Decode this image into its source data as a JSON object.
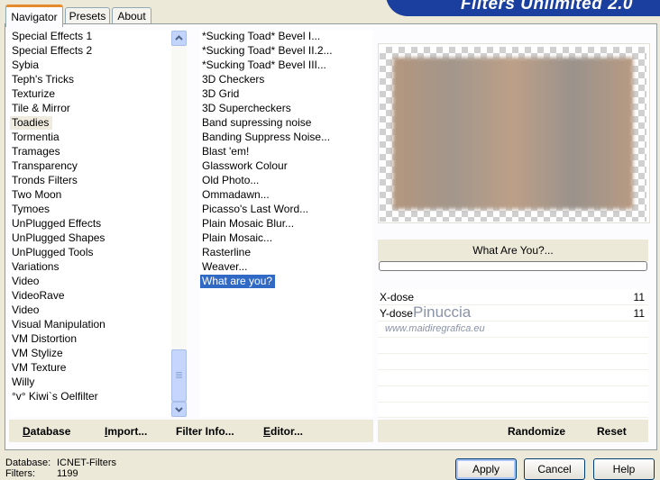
{
  "tabs": [
    "Navigator",
    "Presets",
    "About"
  ],
  "title": "Filters Unlimited 2.0",
  "categories": [
    "Special Effects 1",
    "Special Effects 2",
    "Sybia",
    "Teph's Tricks",
    "Texturize",
    "Tile & Mirror",
    "Toadies",
    "Tormentia",
    "Tramages",
    "Transparency",
    "Tronds Filters",
    "Two Moon",
    "Tymoes",
    "UnPlugged Effects",
    "UnPlugged Shapes",
    "UnPlugged Tools",
    "Variations",
    "Video",
    "VideoRave",
    "Video",
    "Visual Manipulation",
    "VM Distortion",
    "VM Stylize",
    "VM Texture",
    "Willy",
    "°v° Kiwi`s Oelfilter"
  ],
  "filters": [
    "*Sucking Toad*  Bevel I...",
    "*Sucking Toad*  Bevel II.2...",
    "*Sucking Toad*  Bevel III...",
    "3D Checkers",
    "3D Grid",
    "3D Supercheckers",
    "Band supressing noise",
    "Banding Suppress Noise...",
    "Blast 'em!",
    "Glasswork Colour",
    "Old Photo...",
    "Ommadawn...",
    "Picasso's Last Word...",
    "Plain Mosaic Blur...",
    "Plain Mosaic...",
    "Rasterline",
    "Weaver...",
    "What are you?"
  ],
  "highlighted_category": "Toadies",
  "selected_filter": "What are you?",
  "filter_title": "What Are You?...",
  "params": [
    {
      "name": "X-dose",
      "value": "11"
    },
    {
      "name": "Y-dose",
      "value": "11"
    }
  ],
  "watermark": {
    "name": "Pinuccia",
    "url": "www.maidiregrafica.eu"
  },
  "left_buttons": {
    "database": "Database",
    "import": "Import...",
    "filter_info": "Filter Info...",
    "editor": "Editor..."
  },
  "right_buttons": {
    "randomize": "Randomize",
    "reset": "Reset"
  },
  "status": {
    "database_label": "Database:",
    "database_value": "ICNET-Filters",
    "filters_label": "Filters:",
    "filters_value": "1199"
  },
  "dialog_buttons": {
    "apply": "Apply",
    "cancel": "Cancel",
    "help": "Help"
  }
}
